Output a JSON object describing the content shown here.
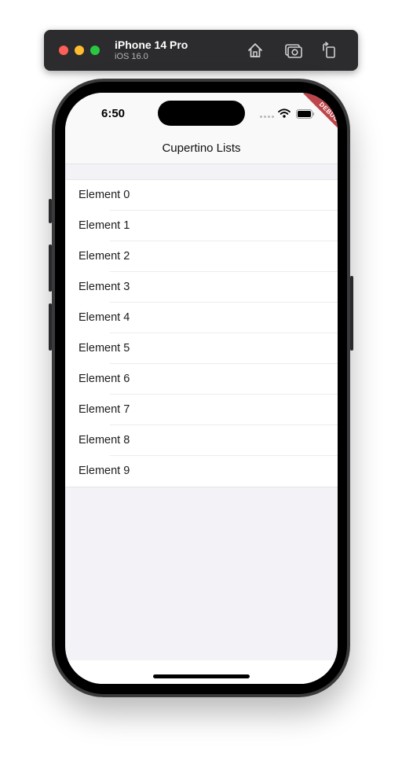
{
  "simulator": {
    "device_name": "iPhone 14 Pro",
    "os_version": "iOS 16.0"
  },
  "status_bar": {
    "time": "6:50"
  },
  "debug_banner": "DEBUG",
  "nav": {
    "title": "Cupertino Lists"
  },
  "list": {
    "items": [
      {
        "label": "Element 0"
      },
      {
        "label": "Element 1"
      },
      {
        "label": "Element 2"
      },
      {
        "label": "Element 3"
      },
      {
        "label": "Element 4"
      },
      {
        "label": "Element 5"
      },
      {
        "label": "Element 6"
      },
      {
        "label": "Element 7"
      },
      {
        "label": "Element 8"
      },
      {
        "label": "Element 9"
      }
    ]
  },
  "icons": {
    "toolbar": [
      "home-icon",
      "screenshot-icon",
      "rotate-icon"
    ],
    "status": [
      "cellular-signal-icon",
      "wifi-icon",
      "battery-icon"
    ]
  },
  "colors": {
    "close": "#ff5f57",
    "minimize": "#febc2e",
    "zoom": "#28c840",
    "debug_ribbon": "#b3272c",
    "grouped_background": "#f2f2f7"
  }
}
